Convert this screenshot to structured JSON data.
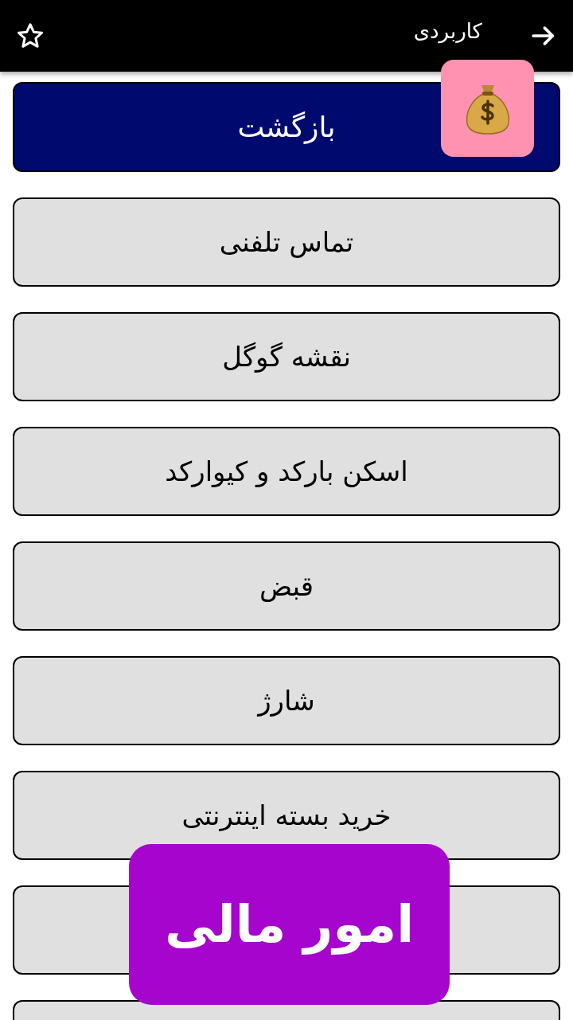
{
  "header": {
    "title": "کاربردی"
  },
  "back_button": {
    "label": "بازگشت"
  },
  "menu_items": [
    {
      "label": "تماس تلفنی"
    },
    {
      "label": "نقشه گوگل"
    },
    {
      "label": "اسکن بارکد و کیوارکد"
    },
    {
      "label": "قبض"
    },
    {
      "label": "شارژ"
    },
    {
      "label": "خرید بسته اینترنتی"
    }
  ],
  "overlay_badge": {
    "label": "امور مالی"
  }
}
